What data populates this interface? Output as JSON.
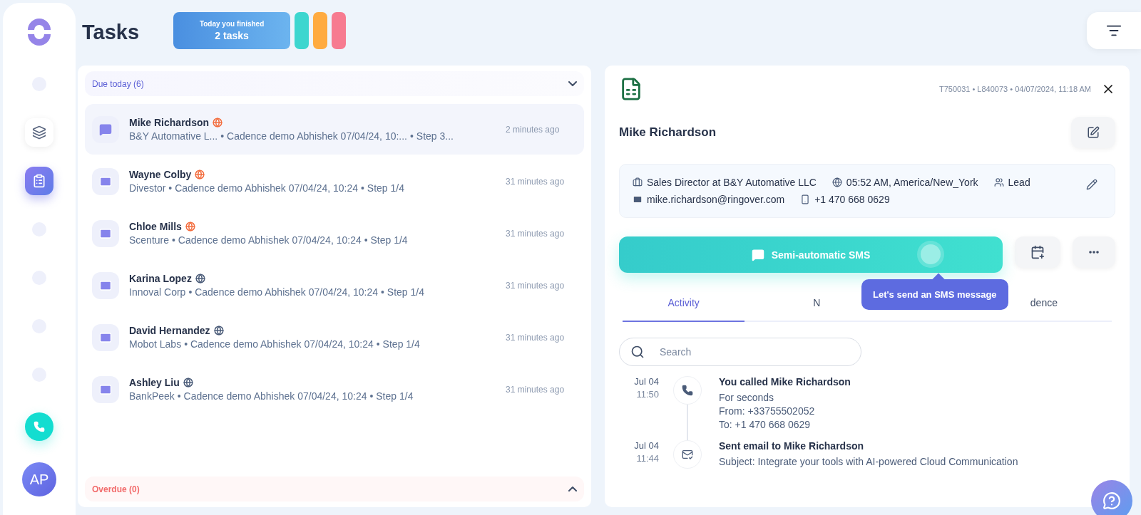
{
  "sidebar": {
    "items": [
      {
        "kind": "dot",
        "selected": false
      },
      {
        "kind": "stack",
        "selected": false
      },
      {
        "kind": "tasks",
        "selected": true
      },
      {
        "kind": "dot",
        "selected": false
      },
      {
        "kind": "dot",
        "selected": false
      },
      {
        "kind": "dot",
        "selected": false
      },
      {
        "kind": "dot",
        "selected": false
      }
    ],
    "avatar": "AP"
  },
  "header": {
    "title": "Tasks",
    "banner": {
      "line1": "Today you finished",
      "line2": "2 tasks"
    },
    "pills": [
      {
        "color": "#3dd6cf"
      },
      {
        "color": "#ffab40"
      },
      {
        "color": "#f77b90"
      }
    ]
  },
  "due_today": {
    "label": "Due today (6)",
    "expanded": true
  },
  "tasks": [
    {
      "kind": "sms",
      "name": "Mike Richardson",
      "color": "#f36c3d",
      "company": "B&Y Automative L...",
      "cadence": "• Cadence demo Abhishek 07/04/24, 10:...",
      "step": "• Step 3...",
      "time": "2 minutes ago",
      "selected": true
    },
    {
      "kind": "email",
      "name": "Wayne Colby",
      "color": "#f36c3d",
      "company": "Divestor",
      "cadence": "• Cadence demo Abhishek 07/04/24, 10:24",
      "step": "• Step 1/4",
      "time": "31 minutes ago",
      "selected": false
    },
    {
      "kind": "email",
      "name": "Chloe Mills",
      "color": "#f36c3d",
      "company": "Scenture",
      "cadence": "• Cadence demo Abhishek 07/04/24, 10:24",
      "step": "• Step 1/4",
      "time": "31 minutes ago",
      "selected": false
    },
    {
      "kind": "email",
      "name": "Karina Lopez",
      "color": "#4a5b78",
      "company": "Innoval Corp",
      "cadence": "• Cadence demo Abhishek 07/04/24, 10:24",
      "step": "• Step 1/4",
      "time": "31 minutes ago",
      "selected": false
    },
    {
      "kind": "email",
      "name": "David Hernandez",
      "color": "#4a5b78",
      "company": "Mobot Labs",
      "cadence": "• Cadence demo Abhishek 07/04/24, 10:24",
      "step": "• Step 1/4",
      "time": "31 minutes ago",
      "selected": false
    },
    {
      "kind": "email",
      "name": "Ashley Liu",
      "color": "#4a5b78",
      "company": "BankPeek",
      "cadence": "• Cadence demo Abhishek 07/04/24, 10:24",
      "step": "• Step 1/4",
      "time": "31 minutes ago",
      "selected": false
    }
  ],
  "overdue": {
    "label": "Overdue (0)",
    "expanded": false
  },
  "detail": {
    "meta": "T750031 • L840073 • 04/07/2024, 11:18 AM",
    "name": "Mike Richardson",
    "job": "Sales Director at B&Y Automative LLC",
    "local_time": "05:52 AM, America/New_York",
    "type": "Lead",
    "email": "mike.richardson@ringover.com",
    "phone": "+1 470 668 0629",
    "action": "Semi-automatic SMS",
    "tooltip": "Let's send an SMS message",
    "tabs": [
      {
        "label": "Activity",
        "selected": true
      },
      {
        "label": "N",
        "selected": false
      },
      {
        "label": "dence",
        "selected": false
      }
    ],
    "search": {
      "placeholder": "Search"
    },
    "activity": [
      {
        "kind": "call",
        "date": "Jul 04",
        "time": "11:50",
        "title": "You called Mike Richardson",
        "lines": [
          "For seconds",
          "From: +33755502052",
          "To: +1 470 668 0629"
        ]
      },
      {
        "kind": "email",
        "date": "Jul 04",
        "time": "11:44",
        "title": "Sent email to Mike Richardson",
        "lines": [
          "Subject: Integrate your tools with AI-powered Cloud Communication"
        ]
      }
    ]
  }
}
